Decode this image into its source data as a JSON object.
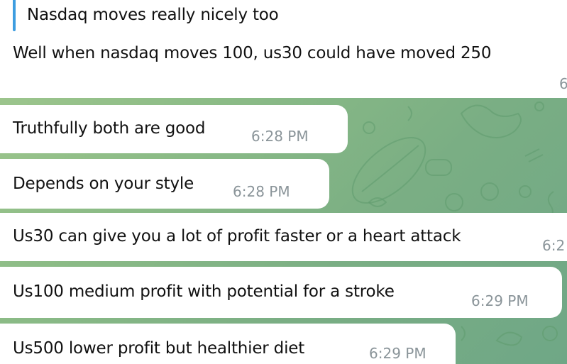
{
  "theme": {
    "bubble_color": "#ffffff",
    "text_color": "#111111",
    "time_color": "#8a9499",
    "quote_accent": "#3d9de0",
    "wallpaper_color": "#8fb98a"
  },
  "messages": [
    {
      "quote": "Nasdaq moves really nicely too",
      "text": "Well when nasdaq moves 100, us30 could have moved 250",
      "time": "6"
    },
    {
      "text": "Truthfully both are good",
      "time": "6:28 PM"
    },
    {
      "text": "Depends on your style",
      "time": "6:28 PM"
    },
    {
      "text": "Us30 can give you a lot of profit faster or a heart attack",
      "time": "6:2"
    },
    {
      "text": "Us100 medium profit with potential for a stroke",
      "time": "6:29 PM"
    },
    {
      "text": "Us500 lower profit but healthier diet",
      "time": "6:29 PM"
    }
  ]
}
